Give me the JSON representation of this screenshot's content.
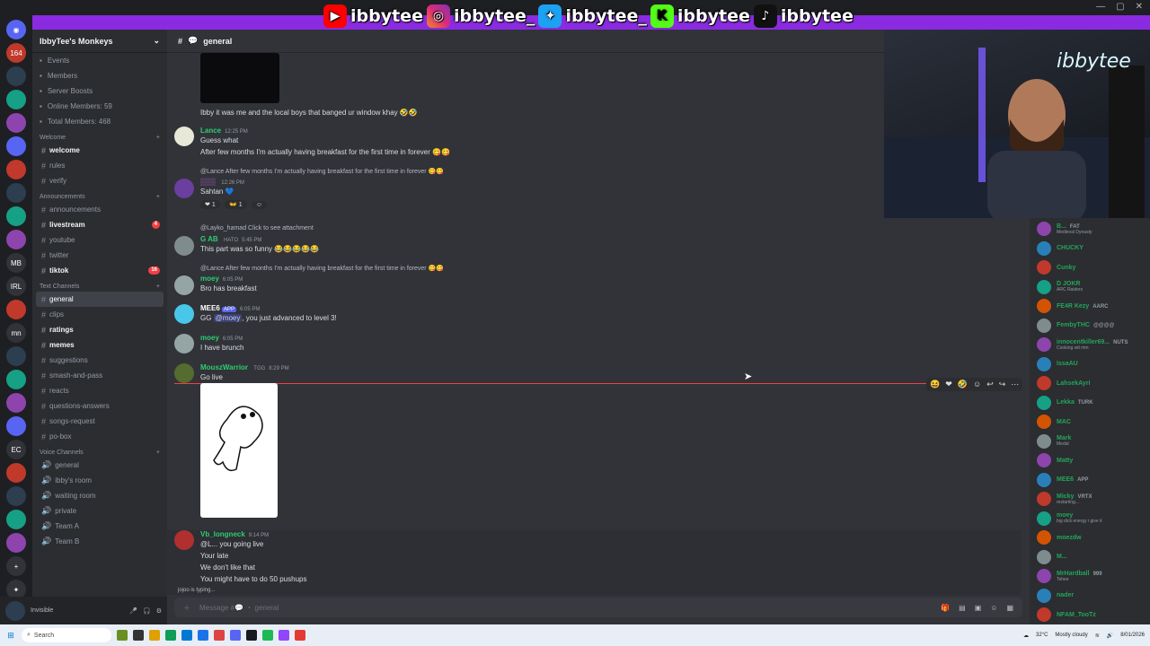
{
  "overlay": {
    "handles": [
      "ibbytee",
      "ibbytee_",
      "ibbytee_",
      "ibbytee",
      "ibbytee"
    ]
  },
  "servers": [
    "164",
    "MB",
    "IRL",
    "mn",
    "EC"
  ],
  "guild": {
    "name": "IbbyTee's Monkeys"
  },
  "nav": [
    {
      "icon": "calendar-icon",
      "label": "Events"
    },
    {
      "icon": "members-icon",
      "label": "Members"
    },
    {
      "icon": "boost-icon",
      "label": "Server Boosts"
    },
    {
      "icon": "stats-icon",
      "label": "Online Members: 59"
    },
    {
      "icon": "stats-icon",
      "label": "Total Members: 468"
    }
  ],
  "categories": {
    "welcome": "Welcome",
    "announcements": "Announcements",
    "text": "Text Channels",
    "voice": "Voice Channels"
  },
  "channels_welcome": [
    {
      "name": "welcome",
      "bold": true
    },
    {
      "name": "rules"
    },
    {
      "name": "verify"
    }
  ],
  "channels_announcements": [
    {
      "name": "announcements"
    },
    {
      "name": "livestream",
      "bold": true,
      "badge": "4"
    },
    {
      "name": "youtube"
    },
    {
      "name": "twitter"
    },
    {
      "name": "tiktok",
      "bold": true,
      "badge": "16"
    }
  ],
  "channels_text": [
    {
      "name": "general",
      "active": true
    },
    {
      "name": "clips"
    },
    {
      "name": "ratings",
      "bold": true
    },
    {
      "name": "memes",
      "bold": true
    },
    {
      "name": "suggestions"
    },
    {
      "name": "smash-and-pass"
    },
    {
      "name": "reacts"
    },
    {
      "name": "questions-answers"
    },
    {
      "name": "songs-request"
    },
    {
      "name": "po-box"
    }
  ],
  "channels_voice": [
    {
      "name": "general"
    },
    {
      "name": "ibby's room"
    },
    {
      "name": "waiting room"
    },
    {
      "name": "private"
    },
    {
      "name": "Team A"
    },
    {
      "name": "Team B"
    }
  ],
  "userbar": {
    "status": "Invisible"
  },
  "header": {
    "channel": "general"
  },
  "messages": {
    "m0": {
      "text": "Ibby it was me and the local boys that banged ur window khay 🤣🤣"
    },
    "m1": {
      "user": "Lance",
      "time": "12:25 PM",
      "line1": "Guess what",
      "line2": "After few months I'm actually having breakfast for the first time in forever 😋😋"
    },
    "m2": {
      "reply": "@Lance After few months I'm actually having breakfast for the first time in forever 😋😋",
      "time": "12:26 PM",
      "text": "Sahtan 💙",
      "react1": "1",
      "react2": "1"
    },
    "m3": {
      "reply": "@Layko_hamad Click to see attachment",
      "user": "G AB",
      "tag": "HATO",
      "time": "5:45 PM",
      "text": "This part was so funny 😂😂😂😂😂"
    },
    "m4": {
      "reply": "@Lance After few months I'm actually having breakfast for the first time in forever 😋😋",
      "user": "moey",
      "time": "6:05 PM",
      "text": "Bro has breakfast"
    },
    "m5": {
      "user": "MEE6",
      "tag": "APP",
      "time": "6:05 PM",
      "pre": "GG ",
      "mention": "@moey",
      "text": ", you just advanced to level 3!"
    },
    "m6": {
      "user": "moey",
      "time": "6:05 PM",
      "text": "I have brunch"
    },
    "m7": {
      "user": "MouszWarrior",
      "tag": "TGG",
      "time": "8:29 PM",
      "text": "Go live"
    },
    "m8": {
      "user": "Vb_longneck",
      "time": "9:14 PM",
      "l1": "@L... you going live",
      "l2": "Your late",
      "l3": "We don't like that",
      "l4": "You might have to do 50 pushups"
    }
  },
  "typing": "jojoo is typing...",
  "composer": {
    "placeholder": "Message #💬 ・ general"
  },
  "members": [
    {
      "name": "B...",
      "tag": "FAT",
      "sub": "Medieval Dynasty"
    },
    {
      "name": "CHUCKY"
    },
    {
      "name": "Cunky"
    },
    {
      "name": "D JOKR",
      "sub": "ARC Raiders"
    },
    {
      "name": "FE4R Kezy",
      "tag": "AARC"
    },
    {
      "name": "FembyTHC",
      "tag": "@@@@"
    },
    {
      "name": "innocentkiller69...",
      "tag": "NUTS",
      "sub": "Cooking wit mm"
    },
    {
      "name": "IssaAU"
    },
    {
      "name": "LahsekAyri"
    },
    {
      "name": "Lekka",
      "tag": "TURK"
    },
    {
      "name": "MAC"
    },
    {
      "name": "Mark",
      "sub": "Medal"
    },
    {
      "name": "Matty"
    },
    {
      "name": "MEE6",
      "tag": "APP"
    },
    {
      "name": "Micky",
      "tag": "VRTX",
      "sub": "restarting..."
    },
    {
      "name": "moey",
      "sub": "big dick energy i give it"
    },
    {
      "name": "moezdw"
    },
    {
      "name": "M..."
    },
    {
      "name": "MrHardball",
      "tag": "999",
      "sub": "Tehee"
    },
    {
      "name": "nader"
    },
    {
      "name": "NFAM_TooTz"
    }
  ],
  "webcam": {
    "sign": "ibbytee"
  },
  "taskbar": {
    "search": "Search",
    "weather_temp": "32°C",
    "weather_desc": "Mostly cloudy",
    "date": "8/01/2026"
  }
}
